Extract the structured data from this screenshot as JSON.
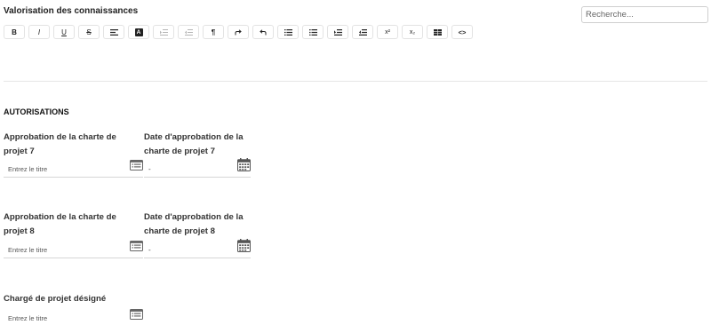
{
  "knowledge": {
    "label": "Valorisation des connaissances"
  },
  "search": {
    "placeholder": "Recherche..."
  },
  "toolbar": {
    "buttons": [
      {
        "name": "bold-button",
        "text": "B"
      },
      {
        "name": "italic-button",
        "text": "I"
      },
      {
        "name": "underline-button",
        "text": "U"
      },
      {
        "name": "strikethrough-button",
        "text": "S"
      },
      {
        "name": "align-left-button",
        "icon": "align-left-icon"
      },
      {
        "name": "text-color-button",
        "text": "A"
      },
      {
        "name": "indent-disabled-button",
        "icon": "indent-icon",
        "disabled": true
      },
      {
        "name": "outdent-disabled-button",
        "icon": "outdent-icon",
        "disabled": true
      },
      {
        "name": "paragraph-button",
        "text": "¶"
      },
      {
        "name": "redo-button",
        "icon": "redo-icon"
      },
      {
        "name": "undo-button",
        "icon": "undo-icon"
      },
      {
        "name": "ordered-list-button",
        "icon": "ordered-list-icon"
      },
      {
        "name": "unordered-list-button",
        "icon": "unordered-list-icon"
      },
      {
        "name": "indent-button",
        "icon": "indent-icon"
      },
      {
        "name": "outdent-button",
        "icon": "outdent-icon"
      },
      {
        "name": "superscript-button",
        "text": "x²"
      },
      {
        "name": "subscript-button",
        "text": "x₂"
      },
      {
        "name": "table-button",
        "icon": "table-icon"
      },
      {
        "name": "code-button",
        "text": "<>"
      }
    ]
  },
  "section": {
    "title": "AUTORISATIONS"
  },
  "fields": {
    "charte7_label": "Approbation de la charte de projet 7",
    "date7_label": "Date d'approbation de la charte de projet 7",
    "charte8_label": "Approbation de la charte de projet 8",
    "date8_label": "Date d'approbation de la charte de projet 8",
    "charge_label": "Chargé de projet désigné",
    "title_placeholder": "Entrez le titre",
    "date_value": "-"
  },
  "icons": {
    "list_icon": "list-picker-icon",
    "calendar_icon": "calendar-icon"
  }
}
